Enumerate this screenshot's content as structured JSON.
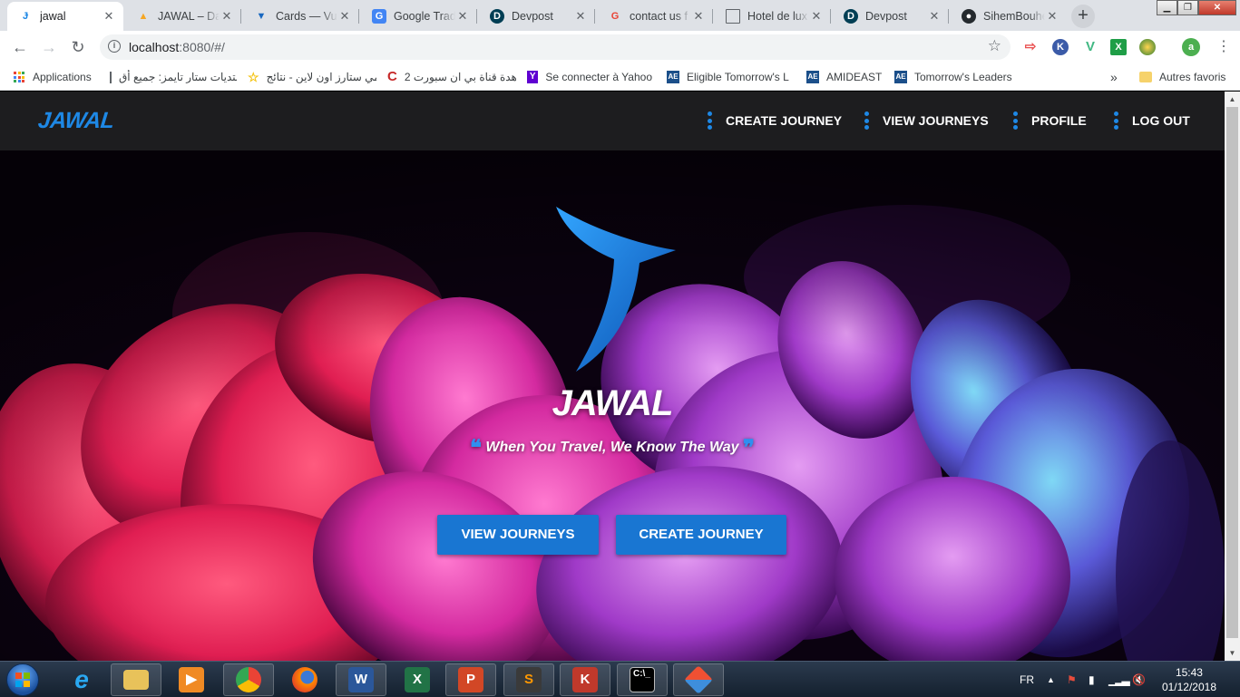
{
  "browser": {
    "tabs": [
      {
        "title": "jawal",
        "icon": "jawal-favicon",
        "active": true
      },
      {
        "title": "JAWAL – Da",
        "icon": "firebase-favicon"
      },
      {
        "title": "Cards — Vu",
        "icon": "vuetify-favicon"
      },
      {
        "title": "Google Trad",
        "icon": "google-translate-favicon"
      },
      {
        "title": "Devpost",
        "icon": "devpost-favicon"
      },
      {
        "title": "contact us f",
        "icon": "google-favicon"
      },
      {
        "title": "Hotel de lux",
        "icon": "page-favicon"
      },
      {
        "title": "Devpost",
        "icon": "devpost-favicon"
      },
      {
        "title": "SihemBouhe",
        "icon": "github-favicon"
      }
    ],
    "url_host": "localhost",
    "url_path": ":8080/#/",
    "profile_initial": "a",
    "bookmarks": [
      {
        "label": "Applications"
      },
      {
        "label": "منتديات ستار تايمز: جميع أق"
      },
      {
        "label": "انمي ستارز اون لاين - نتائج"
      },
      {
        "label": "مشاهدة قناة بي ان سبورت 2"
      },
      {
        "label": "Se connecter à Yahoo"
      },
      {
        "label": "Eligible Tomorrow's L"
      },
      {
        "label": "AMIDEAST"
      },
      {
        "label": "Tomorrow's Leaders"
      }
    ],
    "bookmarks_overflow": "»",
    "other_bookmarks": "Autres favoris"
  },
  "site": {
    "brand": "JAWAL",
    "nav": [
      {
        "label": "CREATE JOURNEY"
      },
      {
        "label": "VIEW JOURNEYS"
      },
      {
        "label": "PROFILE"
      },
      {
        "label": "LOG OUT"
      }
    ],
    "hero": {
      "title": "JAWAL",
      "tagline": "When You Travel, We Know The Way",
      "buttons": [
        {
          "label": "VIEW JOURNEYS"
        },
        {
          "label": "CREATE JOURNEY"
        }
      ]
    },
    "accent_color": "#1e88e5"
  },
  "taskbar": {
    "language": "FR",
    "time": "15:43",
    "date": "01/12/2018",
    "apps": [
      "file-explorer",
      "internet-explorer",
      "media-player",
      "chrome",
      "firefox",
      "word",
      "excel",
      "powerpoint",
      "sublime-text",
      "kaspersky",
      "command-prompt",
      "git"
    ]
  }
}
